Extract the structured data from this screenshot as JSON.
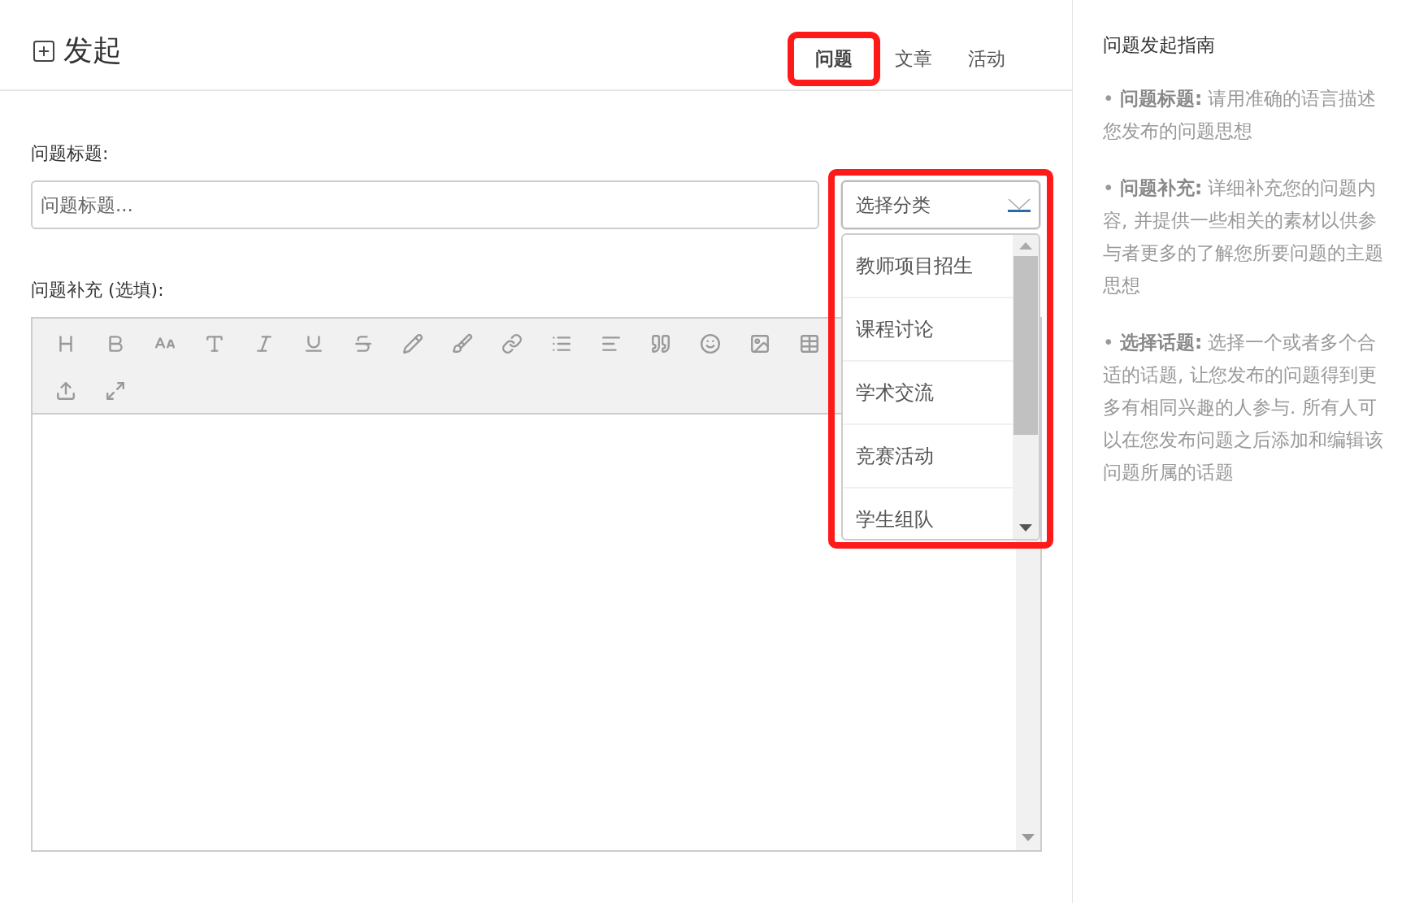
{
  "header": {
    "title": "发起",
    "tabs": [
      {
        "label": "问题",
        "selected": true,
        "highlighted": true
      },
      {
        "label": "文章",
        "selected": false,
        "highlighted": false
      },
      {
        "label": "活动",
        "selected": false,
        "highlighted": false
      }
    ]
  },
  "form": {
    "title_label": "问题标题:",
    "title_input": {
      "placeholder": "问题标题..."
    },
    "category_select": {
      "placeholder": "选择分类",
      "expanded": true,
      "highlighted": true,
      "options": [
        "教师项目招生",
        "课程讨论",
        "学术交流",
        "竞赛活动",
        "学生组队"
      ]
    },
    "detail_label": "问题补充 (选填):",
    "toolbar_rows": [
      [
        {
          "kind": "heading"
        },
        {
          "kind": "bold"
        },
        {
          "kind": "text-size"
        },
        {
          "kind": "font"
        },
        {
          "kind": "italic"
        },
        {
          "kind": "underline"
        },
        {
          "kind": "strikethrough"
        },
        {
          "kind": "pencil"
        },
        {
          "kind": "brush"
        },
        {
          "kind": "link"
        },
        {
          "kind": "list"
        },
        {
          "kind": "align"
        },
        {
          "kind": "quote"
        },
        {
          "kind": "emoji"
        },
        {
          "kind": "image"
        },
        {
          "kind": "table"
        }
      ],
      [
        {
          "kind": "upload"
        },
        {
          "kind": "fullscreen"
        }
      ]
    ]
  },
  "sidebar": {
    "title": "问题发起指南",
    "tips": [
      "• **问题标题:** 请用准确的语言描述您发布的问题思想",
      "• **问题补充:** 详细补充您的问题内容, 并提供一些相关的素材以供参与者更多的了解您所要问题的主题思想",
      "• **选择话题:** 选择一个或者多个合适的话题, 让您发布的问题得到更多有相同兴趣的人参与. 所有人可以在您发布问题之后添加和编辑该问题所属的话题"
    ]
  }
}
